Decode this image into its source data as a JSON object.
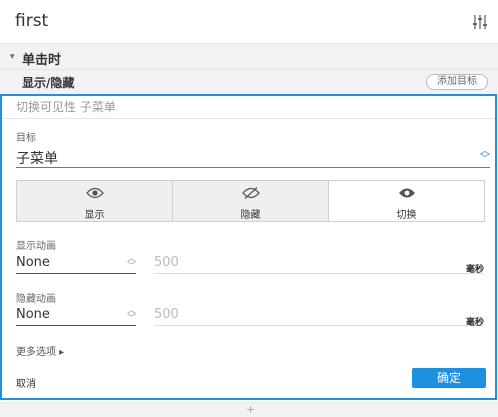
{
  "header": {
    "title": "first",
    "filter_icon": "sliders-icon"
  },
  "section": {
    "caret": "▾",
    "title": "单击时"
  },
  "action": {
    "title": "显示/隐藏",
    "add_target_label": "添加目标"
  },
  "panel": {
    "summary": "切换可见性 子菜单",
    "target_label": "目标",
    "target_value": "子菜单",
    "modes": [
      {
        "label": "显示",
        "icon": "eye-icon"
      },
      {
        "label": "隐藏",
        "icon": "eye-slash-icon"
      },
      {
        "label": "切换",
        "icon": "eye-filled-icon"
      }
    ],
    "show_anim": {
      "label": "显示动画",
      "value": "None",
      "duration": "500",
      "unit": "毫秒"
    },
    "hide_anim": {
      "label": "隐藏动画",
      "value": "None",
      "duration": "500",
      "unit": "毫秒"
    },
    "more_options": "更多选项 ▸",
    "cancel": "取消",
    "ok": "确定"
  },
  "bottom": {
    "plus": "+"
  },
  "colors": {
    "accent": "#1e90e0"
  }
}
